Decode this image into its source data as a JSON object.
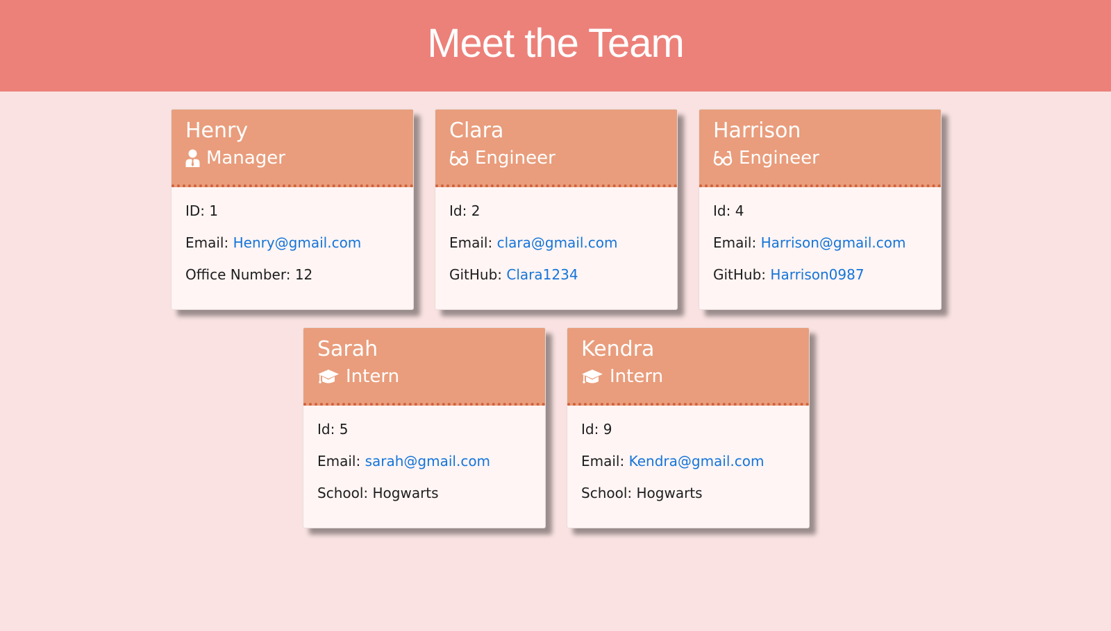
{
  "header": {
    "title": "Meet the Team"
  },
  "colors": {
    "header_bg": "#ec817a",
    "page_bg": "#f9e2e1",
    "card_head_bg": "#e99d7c",
    "card_body_bg": "#fef5f4",
    "link": "#1574d9"
  },
  "cards": [
    {
      "name": "Henry",
      "role": "Manager",
      "icon": "manager-icon",
      "id_label": "ID:",
      "id_value": "1",
      "email_label": "Email:",
      "email": "Henry@gmail.com",
      "extra_label": "Office Number:",
      "extra_value": "12"
    },
    {
      "name": "Clara",
      "role": "Engineer",
      "icon": "glasses-icon",
      "id_label": "Id:",
      "id_value": "2",
      "email_label": "Email:",
      "email": "clara@gmail.com",
      "extra_label": "GitHub:",
      "extra_value": "Clara1234"
    },
    {
      "name": "Harrison",
      "role": "Engineer",
      "icon": "glasses-icon",
      "id_label": "Id:",
      "id_value": "4",
      "email_label": "Email:",
      "email": "Harrison@gmail.com",
      "extra_label": "GitHub:",
      "extra_value": "Harrison0987"
    },
    {
      "name": "Sarah",
      "role": "Intern",
      "icon": "graduation-cap-icon",
      "id_label": "Id:",
      "id_value": "5",
      "email_label": "Email:",
      "email": "sarah@gmail.com",
      "extra_label": "School:",
      "extra_value": "Hogwarts"
    },
    {
      "name": "Kendra",
      "role": "Intern",
      "icon": "graduation-cap-icon",
      "id_label": "Id:",
      "id_value": "9",
      "email_label": "Email:",
      "email": "Kendra@gmail.com",
      "extra_label": "School:",
      "extra_value": "Hogwarts"
    }
  ]
}
